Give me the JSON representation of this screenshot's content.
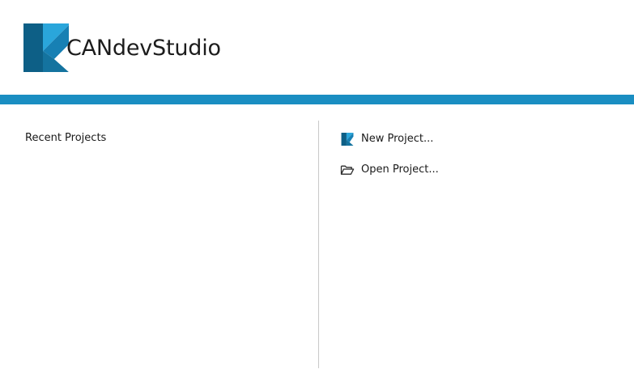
{
  "app": {
    "brand_name": "CANdevStudio",
    "logo_icon": "candevstudio-logo-icon",
    "colors": {
      "accent_bar": "#1a8ec2",
      "logo_dark": "#0d5f86",
      "logo_mid": "#1780b4",
      "logo_light": "#2aa6db"
    }
  },
  "recent_projects": {
    "title": "Recent Projects",
    "items": []
  },
  "actions": {
    "new_project": {
      "label": "New Project...",
      "icon": "candevstudio-logo-icon"
    },
    "open_project": {
      "label": "Open Project...",
      "icon": "folder-open-icon"
    }
  }
}
